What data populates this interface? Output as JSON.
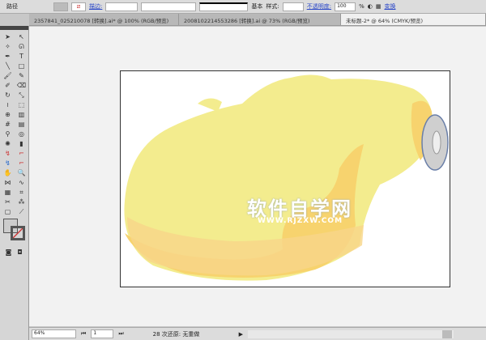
{
  "control_bar": {
    "mode": "路径",
    "stroke_label": "描边:",
    "profile": "基本",
    "style_label": "样式:",
    "opacity_label": "不透明度:",
    "opacity": "100",
    "percent": "%",
    "transform": "变换"
  },
  "tabs": [
    {
      "label": "2357841_025210078 [转换].ai* @ 100% (RGB/预览)"
    },
    {
      "label": "2008102214553286 [转换].ai @ 73% (RGB/预览)"
    },
    {
      "label": "未标题-2* @ 64% (CMYK/预览)",
      "active": true
    }
  ],
  "status": {
    "zoom": "64%",
    "page": "1",
    "message": "28 次还原: 无重做"
  },
  "watermark": {
    "text": "软件自学网",
    "url": "WWW.RJZXW.COM"
  },
  "colors": {
    "car_light": "#f3ec8e",
    "car_dark": "#f7d36e",
    "wheel": "#c8c8c8"
  }
}
